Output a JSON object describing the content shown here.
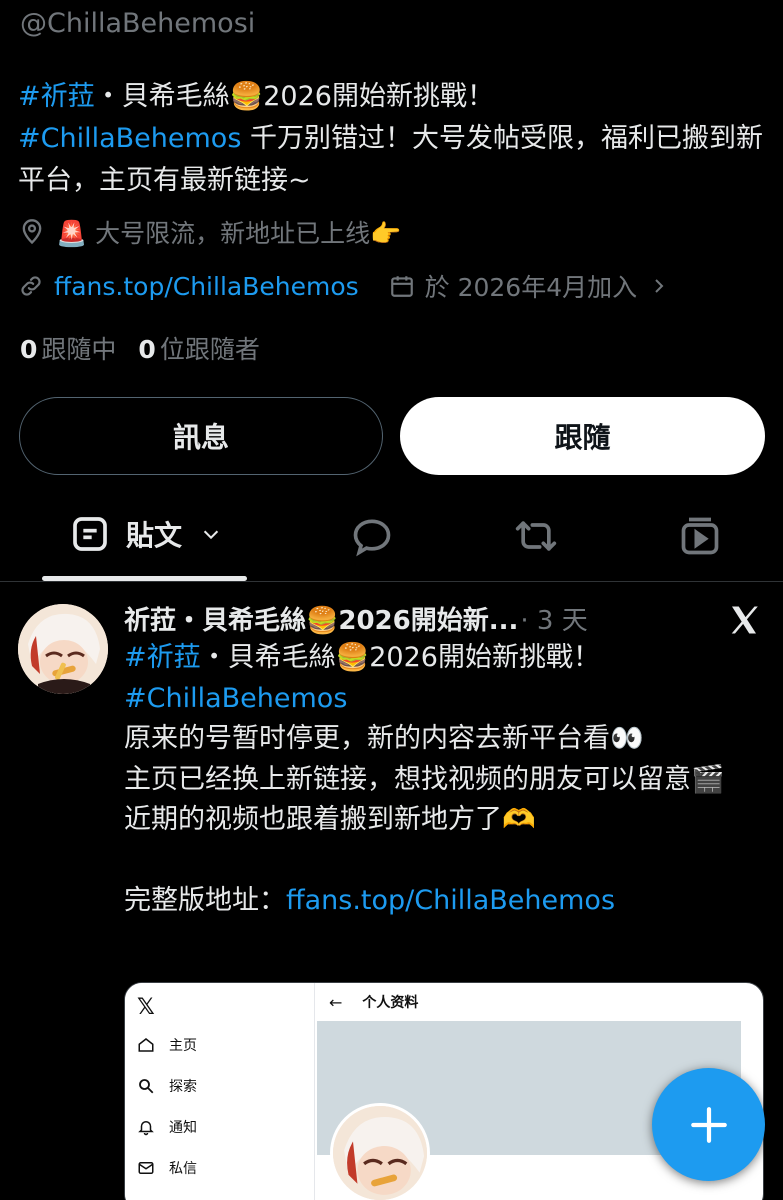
{
  "profile": {
    "handle": "@ChillaBehemosi",
    "bio": {
      "hashtag1": "#祈菈",
      "line1_rest": "・貝希毛絲🍔2026開始新挑戰！",
      "hashtag2": "#ChillaBehemos",
      "line2_rest": " 千万别错过！大号发帖受限，福利已搬到新平台，主页有最新链接~"
    },
    "location": "🚨 大号限流，新地址已上线👉",
    "website": "ffans.top/ChillaBehemos",
    "joined": "於 2026年4月加入",
    "following_count": "0",
    "following_label": "跟隨中",
    "followers_count": "0",
    "followers_label": "位跟隨者"
  },
  "actions": {
    "message_label": "訊息",
    "follow_label": "跟隨"
  },
  "tabs": {
    "posts_label": "貼文",
    "icons": [
      "posts-icon",
      "chevron-down-icon",
      "reply-icon",
      "repost-icon",
      "media-icon"
    ]
  },
  "post": {
    "author_name": "祈菈・貝希毛絲🍔2026開始新...",
    "time": "· 3 天",
    "lines": {
      "hashtag1": "#祈菈",
      "line1_rest": "・貝希毛絲🍔2026開始新挑戰！",
      "hashtag2": "#ChillaBehemos",
      "line3": "原来的号暂时停更，新的内容去新平台看👀",
      "line4": "主页已经换上新链接，想找视频的朋友可以留意🎬",
      "line5": "近期的视频也跟着搬到新地方了🫶",
      "line6_prefix": "完整版地址：",
      "line6_link": "ffans.top/ChillaBehemos"
    }
  },
  "embed": {
    "x_logo": "𝕏",
    "back": "←",
    "title": "个人资料",
    "nav": [
      "主页",
      "探索",
      "通知",
      "私信"
    ]
  },
  "colors": {
    "accent": "#1d9bf0",
    "background": "#000000",
    "text": "#e7e9ea",
    "muted": "#71767b"
  }
}
